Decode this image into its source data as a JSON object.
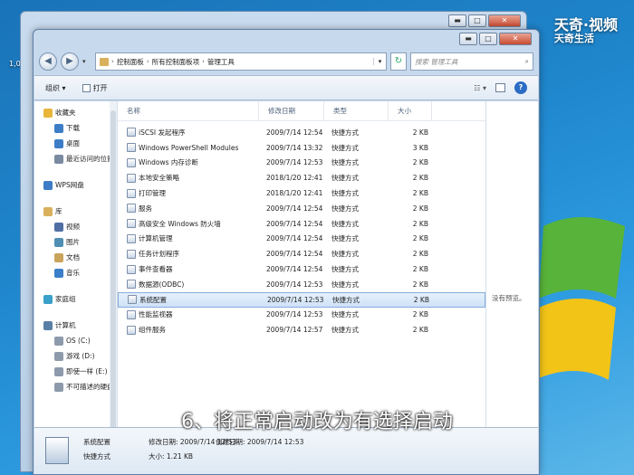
{
  "desktop": {
    "icon_label": "1,0"
  },
  "watermark": {
    "line1": "天奇·视频",
    "line2": "天奇生活"
  },
  "window": {
    "controls": {
      "minimize": "▬",
      "maximize": "□",
      "close": "✕"
    }
  },
  "address": {
    "crumbs": [
      "控制面板",
      "所有控制面板项",
      "管理工具"
    ],
    "search_placeholder": "搜索 管理工具"
  },
  "toolbar": {
    "organize": "组织 ▾",
    "open": "打开"
  },
  "nav": {
    "items": [
      {
        "label": "收藏夹",
        "icon": "star-icon",
        "color": "#e8b63a",
        "level": 0
      },
      {
        "label": "下载",
        "icon": "download-icon",
        "color": "#3d7dc7",
        "level": 1
      },
      {
        "label": "桌面",
        "icon": "desktop-icon",
        "color": "#3d7dc7",
        "level": 1
      },
      {
        "label": "最近访问的位置",
        "icon": "recent-icon",
        "color": "#7a8aa0",
        "level": 1
      },
      {
        "label": "WPS网盘",
        "icon": "cloud-icon",
        "color": "#3d7dc7",
        "level": 0,
        "gap": true
      },
      {
        "label": "库",
        "icon": "library-icon",
        "color": "#d9b05c",
        "level": 0,
        "gap": true
      },
      {
        "label": "视频",
        "icon": "video-icon",
        "color": "#4f6fa3",
        "level": 1
      },
      {
        "label": "图片",
        "icon": "picture-icon",
        "color": "#4f8fb3",
        "level": 1
      },
      {
        "label": "文档",
        "icon": "document-icon",
        "color": "#c9a45a",
        "level": 1
      },
      {
        "label": "音乐",
        "icon": "music-icon",
        "color": "#3a7fc9",
        "level": 1
      },
      {
        "label": "家庭组",
        "icon": "homegroup-icon",
        "color": "#3aa0c9",
        "level": 0,
        "gap": true
      },
      {
        "label": "计算机",
        "icon": "computer-icon",
        "color": "#5a7fa6",
        "level": 0,
        "gap": true
      },
      {
        "label": "OS (C:)",
        "icon": "drive-icon",
        "color": "#8d9aab",
        "level": 1
      },
      {
        "label": "游戏 (D:)",
        "icon": "drive-icon",
        "color": "#8d9aab",
        "level": 1
      },
      {
        "label": "即使一样 (E:)",
        "icon": "drive-icon",
        "color": "#8d9aab",
        "level": 1
      },
      {
        "label": "不可描述的硬盘",
        "icon": "drive-icon",
        "color": "#8d9aab",
        "level": 1
      }
    ]
  },
  "columns": {
    "name": "名称",
    "date": "修改日期",
    "type": "类型",
    "size": "大小"
  },
  "files": [
    {
      "name": "iSCSI 发起程序",
      "date": "2009/7/14 12:54",
      "type": "快捷方式",
      "size": "2 KB"
    },
    {
      "name": "Windows PowerShell Modules",
      "date": "2009/7/14 13:32",
      "type": "快捷方式",
      "size": "3 KB"
    },
    {
      "name": "Windows 内存诊断",
      "date": "2009/7/14 12:53",
      "type": "快捷方式",
      "size": "2 KB"
    },
    {
      "name": "本地安全策略",
      "date": "2018/1/20 12:41",
      "type": "快捷方式",
      "size": "2 KB"
    },
    {
      "name": "打印管理",
      "date": "2018/1/20 12:41",
      "type": "快捷方式",
      "size": "2 KB"
    },
    {
      "name": "服务",
      "date": "2009/7/14 12:54",
      "type": "快捷方式",
      "size": "2 KB"
    },
    {
      "name": "高级安全 Windows 防火墙",
      "date": "2009/7/14 12:54",
      "type": "快捷方式",
      "size": "2 KB"
    },
    {
      "name": "计算机管理",
      "date": "2009/7/14 12:54",
      "type": "快捷方式",
      "size": "2 KB"
    },
    {
      "name": "任务计划程序",
      "date": "2009/7/14 12:54",
      "type": "快捷方式",
      "size": "2 KB"
    },
    {
      "name": "事件查看器",
      "date": "2009/7/14 12:54",
      "type": "快捷方式",
      "size": "2 KB"
    },
    {
      "name": "数据源(ODBC)",
      "date": "2009/7/14 12:53",
      "type": "快捷方式",
      "size": "2 KB"
    },
    {
      "name": "系统配置",
      "date": "2009/7/14 12:53",
      "type": "快捷方式",
      "size": "2 KB",
      "selected": true
    },
    {
      "name": "性能监视器",
      "date": "2009/7/14 12:53",
      "type": "快捷方式",
      "size": "2 KB"
    },
    {
      "name": "组件服务",
      "date": "2009/7/14 12:57",
      "type": "快捷方式",
      "size": "2 KB"
    }
  ],
  "preview": {
    "text": "没有预览。"
  },
  "details": {
    "name": "系统配置",
    "modified": "修改日期: 2009/7/14 12:53",
    "created": "创建日期: 2009/7/14 12:53",
    "type": "快捷方式",
    "size": "大小: 1.21 KB"
  },
  "caption": "6、将正常启动改为有选择启动"
}
